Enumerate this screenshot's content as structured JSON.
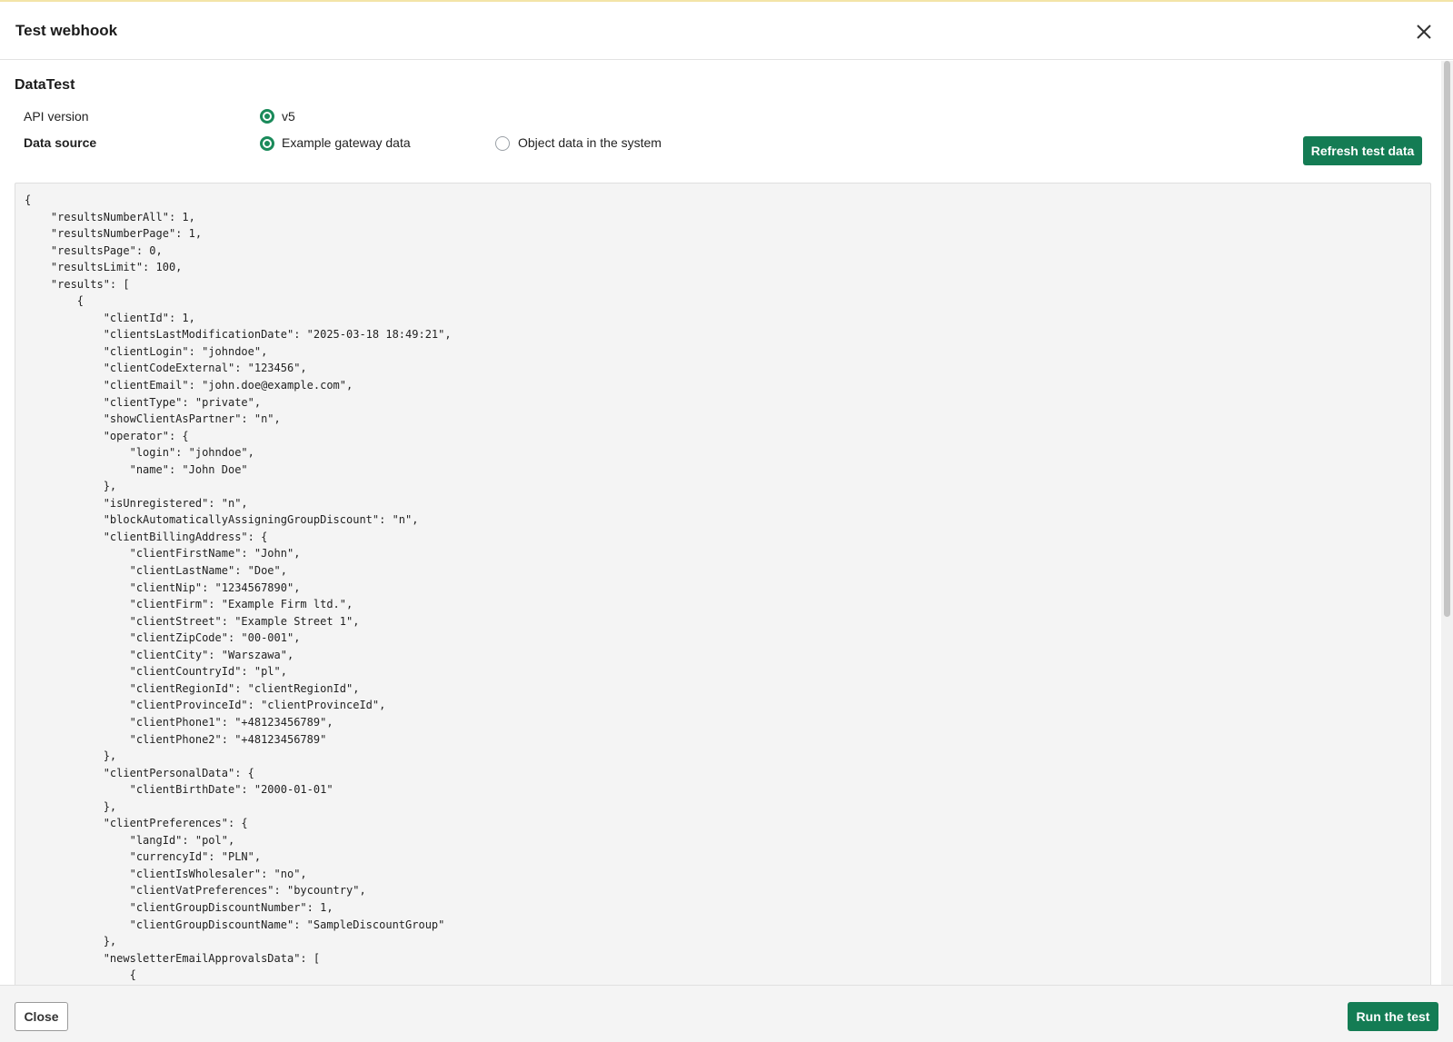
{
  "modal": {
    "title": "Test webhook",
    "close_icon": "close-icon"
  },
  "section": {
    "title": "DataTest"
  },
  "api_version": {
    "label": "API version",
    "options": [
      {
        "label": "v5",
        "selected": true
      }
    ]
  },
  "data_source": {
    "label": "Data source",
    "options": [
      {
        "label": "Example gateway data",
        "selected": true
      },
      {
        "label": "Object data in the system",
        "selected": false
      }
    ]
  },
  "refresh_button": {
    "label": "Refresh test data"
  },
  "json_preview": "{\n    \"resultsNumberAll\": 1,\n    \"resultsNumberPage\": 1,\n    \"resultsPage\": 0,\n    \"resultsLimit\": 100,\n    \"results\": [\n        {\n            \"clientId\": 1,\n            \"clientsLastModificationDate\": \"2025-03-18 18:49:21\",\n            \"clientLogin\": \"johndoe\",\n            \"clientCodeExternal\": \"123456\",\n            \"clientEmail\": \"john.doe@example.com\",\n            \"clientType\": \"private\",\n            \"showClientAsPartner\": \"n\",\n            \"operator\": {\n                \"login\": \"johndoe\",\n                \"name\": \"John Doe\"\n            },\n            \"isUnregistered\": \"n\",\n            \"blockAutomaticallyAssigningGroupDiscount\": \"n\",\n            \"clientBillingAddress\": {\n                \"clientFirstName\": \"John\",\n                \"clientLastName\": \"Doe\",\n                \"clientNip\": \"1234567890\",\n                \"clientFirm\": \"Example Firm ltd.\",\n                \"clientStreet\": \"Example Street 1\",\n                \"clientZipCode\": \"00-001\",\n                \"clientCity\": \"Warszawa\",\n                \"clientCountryId\": \"pl\",\n                \"clientRegionId\": \"clientRegionId\",\n                \"clientProvinceId\": \"clientProvinceId\",\n                \"clientPhone1\": \"+48123456789\",\n                \"clientPhone2\": \"+48123456789\"\n            },\n            \"clientPersonalData\": {\n                \"clientBirthDate\": \"2000-01-01\"\n            },\n            \"clientPreferences\": {\n                \"langId\": \"pol\",\n                \"currencyId\": \"PLN\",\n                \"clientIsWholesaler\": \"no\",\n                \"clientVatPreferences\": \"bycountry\",\n                \"clientGroupDiscountNumber\": 1,\n                \"clientGroupDiscountName\": \"SampleDiscountGroup\"\n            },\n            \"newsletterEmailApprovalsData\": [\n                {",
  "footer": {
    "close_label": "Close",
    "run_label": "Run the test"
  },
  "colors": {
    "accent": "#147c54",
    "radio_checked": "#1a8a5a"
  }
}
